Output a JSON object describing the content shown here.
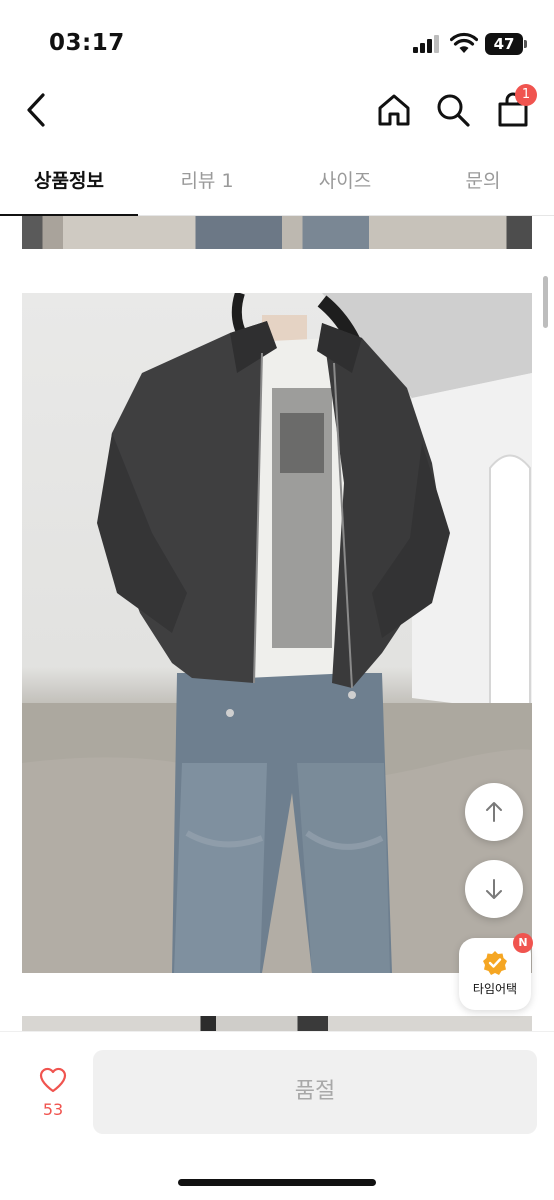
{
  "status_bar": {
    "time": "03:17",
    "battery": "47"
  },
  "nav": {
    "back_icon": "chevron-left-icon",
    "home_icon": "home-icon",
    "search_icon": "search-icon",
    "cart_icon": "shopping-bag-icon",
    "cart_badge": "1"
  },
  "tabs": [
    {
      "label": "상품정보",
      "active": true
    },
    {
      "label": "리뷰 1",
      "active": false
    },
    {
      "label": "사이즈",
      "active": false
    },
    {
      "label": "문의",
      "active": false
    }
  ],
  "floating": {
    "scroll_up_icon": "arrow-up-icon",
    "scroll_down_icon": "arrow-down-icon",
    "time_attack_label": "타임어택",
    "time_attack_badge": "N"
  },
  "bottom_bar": {
    "like_icon": "heart-icon",
    "like_count": "53",
    "soldout_label": "품절"
  },
  "colors": {
    "accent": "#f0544f",
    "text": "#111111",
    "muted": "#9a9a9a",
    "disabled_bg": "#f0f0f0"
  }
}
